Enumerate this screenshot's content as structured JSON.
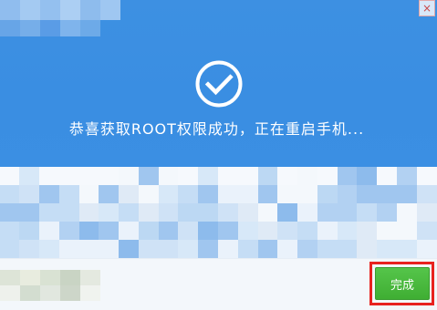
{
  "window": {
    "close_glyph": "×"
  },
  "status": {
    "icon": "check-circle-icon",
    "message": "恭喜获取ROOT权限成功，正在重启手机..."
  },
  "footer": {
    "done_label": "完成"
  },
  "colors": {
    "header_blue": "#3b8fe3",
    "done_green": "#46b43b",
    "highlight_red": "#e8221f"
  }
}
